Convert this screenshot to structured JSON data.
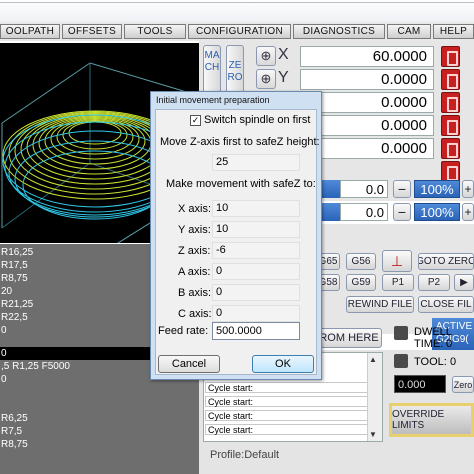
{
  "tabs": [
    "OOLPATH",
    "OFFSETS",
    "TOOLS",
    "CONFIGURATION",
    "DIAGNOSTICS",
    "CAM",
    "HELP"
  ],
  "dro_side": {
    "mach": "MACH",
    "zero": "ZERO"
  },
  "axes": [
    {
      "label": "X",
      "value": "60.0000"
    },
    {
      "label": "Y",
      "value": "0.0000"
    },
    {
      "label": "",
      "value": "0.0000"
    },
    {
      "label": "",
      "value": "0.0000"
    },
    {
      "label": "",
      "value": "0.0000"
    }
  ],
  "spindle_row": {
    "value": "0.0",
    "percent": "100%"
  },
  "feed_row": {
    "value": "0.0",
    "percent": "100%"
  },
  "gcode_buttons": {
    "g65": "G65",
    "g56": "G56",
    "g58": "G58",
    "g59": "G59",
    "goto_zero": "GOTO ZERO",
    "p1": "P1",
    "p2": "P2",
    "rewind": "REWIND FILE",
    "close": "CLOSE FIL"
  },
  "active_panel": {
    "title": "ACTIVE",
    "codes": "G2|G9("
  },
  "run_from_here": "ROM HERE",
  "dwell": {
    "label": "DWELL",
    "time_label": "TIME:",
    "time_value": "0"
  },
  "tool": {
    "label": "TOOL:",
    "value": "0"
  },
  "bottom_value": "0.000",
  "zero_btn": "Zero",
  "override": "OVERRIDE LIMITS",
  "log_lines": [
    "",
    "Cycle start:",
    "Cycle start:",
    "Cycle start:",
    "Cycle start:"
  ],
  "profile": "Profile:Default",
  "gcode_list": [
    "R16,25",
    "R17,5",
    "R8,75",
    "20",
    "R21,25",
    "R22,5",
    "0",
    "R0",
    "0",
    ",5 R1,25 F5000",
    "0",
    "",
    "R6,25",
    "R7,5",
    "R8,75"
  ],
  "dialog": {
    "title": "Initial movement preparation",
    "checkbox_label": "Switch spindle on first",
    "safe_z_label": "Move Z-axis first to safeZ height:",
    "safe_z_value": "25",
    "movement_label": "Make movement with safeZ to:",
    "fields": [
      {
        "label": "X axis:",
        "value": "10"
      },
      {
        "label": "Y axis:",
        "value": "10"
      },
      {
        "label": "Z axis:",
        "value": "-6"
      },
      {
        "label": "A axis:",
        "value": "0"
      },
      {
        "label": "B axis:",
        "value": "0"
      },
      {
        "label": "C axis:",
        "value": "0"
      }
    ],
    "feed_label": "Feed rate:",
    "feed_value": "500.0000",
    "cancel": "Cancel",
    "ok": "OK"
  }
}
